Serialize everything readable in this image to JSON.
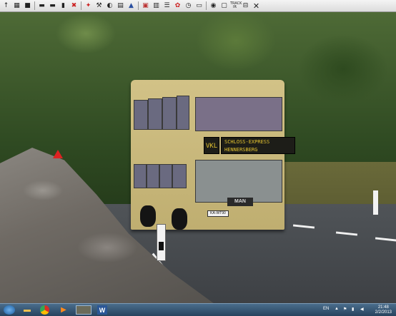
{
  "toolbar": {
    "icons": [
      "arrow-up-icon",
      "map-icon",
      "save-icon",
      "bus-icon",
      "bus-alt-icon",
      "bus-front-icon",
      "close-x-icon",
      "vehicle-icon",
      "wrench-icon",
      "ai-icon",
      "layer-icon",
      "bell-icon",
      "book-icon",
      "timetable-icon",
      "list-icon",
      "settings-icon",
      "clock-icon",
      "camera-icon",
      "window-icon"
    ],
    "track_label_top": "TRACK",
    "track_label_bottom": "IR",
    "sign_icon": "road-sign-icon",
    "close_icon": "close-icon"
  },
  "bus": {
    "route": "VKL",
    "destination_line1": "SCHLOSS-EXPRESS",
    "destination_line2": "HENNERSBERG",
    "brand": "MAN",
    "plate": "KA-WT90"
  },
  "taskbar": {
    "start_icon": "windows-start-icon",
    "apps": [
      "explorer-icon",
      "chrome-icon",
      "media-player-icon",
      "game-app-icon",
      "word-icon"
    ],
    "language": "EN",
    "time": "21:48",
    "date": "2/2/2013"
  },
  "colors": {
    "bus_body": "#d2c287",
    "destination_text": "#e2c230",
    "road": "#505458",
    "taskbar": "#27435e"
  }
}
